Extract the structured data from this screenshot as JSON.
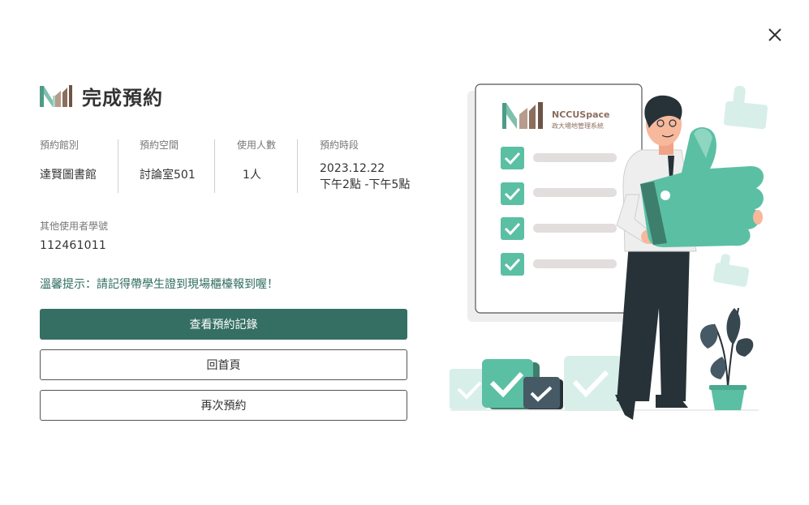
{
  "dialog": {
    "title": "完成預約",
    "close_icon": "close-icon"
  },
  "booking": {
    "library": {
      "label": "預約館別",
      "value": "達賢圖書館"
    },
    "space": {
      "label": "預約空間",
      "value": "討論室501"
    },
    "people": {
      "label": "使用人數",
      "value": "1人"
    },
    "time": {
      "label": "預約時段",
      "date": "2023.12.22",
      "range": "下午2點 -下午5點"
    }
  },
  "other_users": {
    "label": "其他使用者學號",
    "value": "112461011"
  },
  "reminder": "溫馨提示：請記得帶學生證到現場櫃檯報到喔！",
  "buttons": {
    "view_records": "查看預約記錄",
    "home": "回首頁",
    "book_again": "再次預約"
  },
  "illustration": {
    "brand_name": "NCCUSpace",
    "brand_subtitle": "政大場地管理系統"
  },
  "colors": {
    "primary": "#356f64",
    "accent": "#5bbfa4",
    "logo_green": "#4e9c86",
    "logo_brown": "#8b6e5d"
  }
}
